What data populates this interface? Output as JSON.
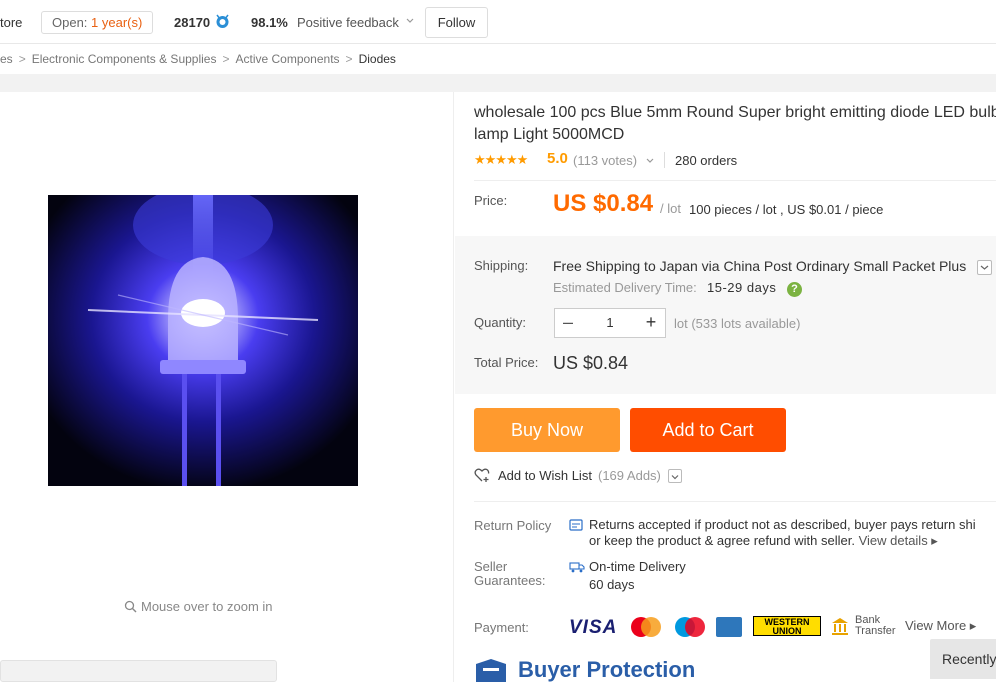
{
  "store": {
    "name": "tore",
    "open_prefix": "Open:",
    "open_years": "1 year(s)",
    "score": "28170",
    "feedback_pct": "98.1%",
    "feedback_label": "Positive feedback",
    "follow_label": "Follow"
  },
  "breadcrumb": {
    "items": [
      "es",
      "Electronic Components & Supplies",
      "Active Components",
      "Diodes"
    ],
    "separator": ">"
  },
  "gallery": {
    "zoom_hint": "Mouse over to zoom in"
  },
  "product": {
    "title": "wholesale 100 pcs Blue 5mm Round Super bright emitting diode LED bulb lamp Light 5000MCD",
    "stars": "★★★★★",
    "rating": "5.0",
    "votes": "(113 votes)",
    "orders": "280 orders",
    "price_label": "Price:",
    "price": "US $0.84",
    "price_unit": "/ lot",
    "price_detail": "100 pieces / lot , US $0.01 / piece"
  },
  "shipping": {
    "label": "Shipping:",
    "text": "Free Shipping to Japan via China Post Ordinary Small Packet Plus",
    "eta_label": "Estimated Delivery Time:",
    "eta_value": "15-29 days",
    "help": "?"
  },
  "quantity": {
    "label": "Quantity:",
    "minus": "–",
    "value": "1",
    "plus": "+",
    "available": "lot (533 lots available)"
  },
  "total": {
    "label": "Total Price:",
    "value": "US $0.84"
  },
  "actions": {
    "buy_now": "Buy Now",
    "add_to_cart": "Add to Cart",
    "wishlist_label": "Add to Wish List",
    "wishlist_count": "(169 Adds)"
  },
  "return_policy": {
    "label": "Return Policy",
    "line1": "Returns accepted if product not as described, buyer pays return shi",
    "line2": "or keep the product & agree refund with seller.",
    "view_details": "View details ▸"
  },
  "seller_guarantees": {
    "label": "Seller Guarantees:",
    "ontime": "On-time Delivery",
    "days": "60 days"
  },
  "payment": {
    "label": "Payment:",
    "visa": "VISA",
    "western_union": "WESTERN UNION",
    "bank_transfer": "Bank Transfer",
    "view_more": "View More ▸"
  },
  "buyer_protection": {
    "title": "Buyer Protection"
  },
  "recently": {
    "label": "Recently"
  },
  "colors": {
    "price_orange": "#ff6a00",
    "buy_now": "#ff9a2e",
    "add_to_cart": "#ff4d00",
    "rating": "#ff9b00",
    "buyer_protection_blue": "#2a5ea8"
  }
}
